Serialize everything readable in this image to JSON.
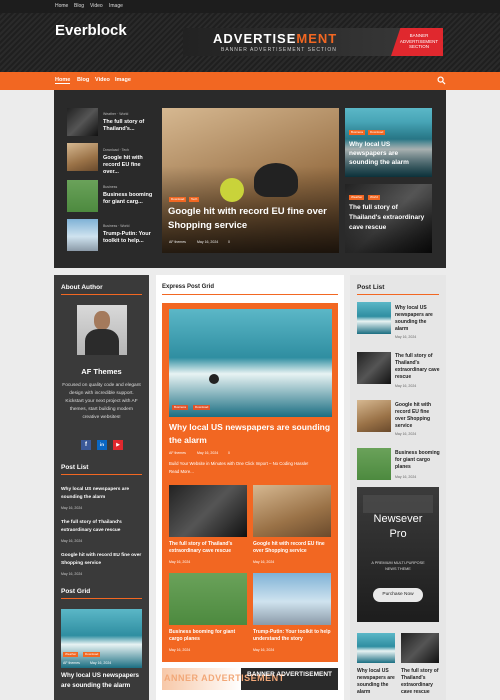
{
  "topbar": {
    "items": [
      "Home",
      "Blog",
      "Video",
      "Image"
    ]
  },
  "site": {
    "title": "Everblock"
  },
  "ad": {
    "title_a": "ADVERTISE",
    "title_b": "MENT",
    "subtitle": "BANNER ADVERTISEMENT SECTION",
    "ribbon": "BANNER ADVERTISEMENT SECTION"
  },
  "nav": {
    "items": [
      "Home",
      "Blog",
      "Video",
      "Image"
    ]
  },
  "hero": {
    "left": [
      {
        "cats": "Weather · World",
        "title": "The full story of Thailand's..."
      },
      {
        "cats": "Download · Tech",
        "title": "Google hit with record EU fine over..."
      },
      {
        "cats": "Business",
        "title": "Business booming for giant carg..."
      },
      {
        "cats": "Business · World",
        "title": "Trump-Putin: Your toolkit to help..."
      }
    ],
    "main": {
      "badges": [
        "Download",
        "Tech"
      ],
      "title": "Google hit with record EU fine over Shopping service",
      "author": "AF themes",
      "date": "May 16, 2024",
      "comments": "0"
    },
    "right_top": {
      "badges": [
        "Business",
        "Download"
      ],
      "title": "Why local US newspapers are sounding the alarm"
    },
    "right_bottom": {
      "badges": [
        "Weather",
        "World"
      ],
      "title": "The full story of Thailand's extraordinary cave rescue"
    }
  },
  "author": {
    "heading": "About Author",
    "name": "AF Themes",
    "bio": "Focused on quality code and elegant design with incredible support. Kickstart your next project with AF themes, start building modern creative websites!"
  },
  "left_posts": {
    "heading": "Post List",
    "items": [
      {
        "title": "Why local US newspapers are sounding the alarm",
        "date": "May 16, 2024"
      },
      {
        "title": "The full story of Thailand's extraordinary cave rescue",
        "date": "May 16, 2024"
      },
      {
        "title": "Google hit with record EU fine over Shopping service",
        "date": "May 16, 2024"
      }
    ]
  },
  "left_grid": {
    "heading": "Post Grid",
    "badges": [
      "Weather",
      "Download"
    ],
    "author": "AF themes",
    "date": "May 16, 2024",
    "title": "Why local US newspapers are sounding the alarm"
  },
  "express": {
    "heading": "Express Post Grid",
    "feature": {
      "badges": [
        "Business",
        "Download"
      ],
      "title": "Why local US newspapers are sounding the alarm",
      "author": "AF themes",
      "date": "May 16, 2024",
      "comments": "0",
      "excerpt": "Build Your Website in Minutes with One Click Import – No Coding Hassle!",
      "more": "Read More..."
    },
    "grid": [
      {
        "title": "The full story of Thailand's extraordinary cave rescue",
        "date": "May 16, 2024"
      },
      {
        "title": "Google hit with record EU fine over Shopping service",
        "date": "May 16, 2024"
      },
      {
        "title": "Business booming for giant cargo planes",
        "date": "May 16, 2024"
      },
      {
        "title": "Trump-Putin: Your toolkit to help understand the story",
        "date": "May 16, 2024"
      }
    ],
    "banner": {
      "a": "ANNER ADVERTISEMENT",
      "b": "BANNER ADVERTISEMENT"
    }
  },
  "right_posts": {
    "heading": "Post List",
    "items": [
      {
        "title": "Why local US newspapers are sounding the alarm",
        "date": "May 16, 2024"
      },
      {
        "title": "The full story of Thailand's extraordinary cave rescue",
        "date": "May 16, 2024"
      },
      {
        "title": "Google hit with record EU fine over Shopping service",
        "date": "May 16, 2024"
      },
      {
        "title": "Business booming for giant cargo planes",
        "date": "May 16, 2024"
      }
    ]
  },
  "promo": {
    "name_a": "Newsever",
    "name_b": "Pro",
    "tagline": "A PREMIUM MULTI-PURPOSE NEWS THEME",
    "button": "Purchase Now"
  },
  "right_bottom_posts": [
    {
      "title": "Why local US newspapers are sounding the alarm"
    },
    {
      "title": "The full story of Thailand's extraordinary cave rescue"
    }
  ]
}
